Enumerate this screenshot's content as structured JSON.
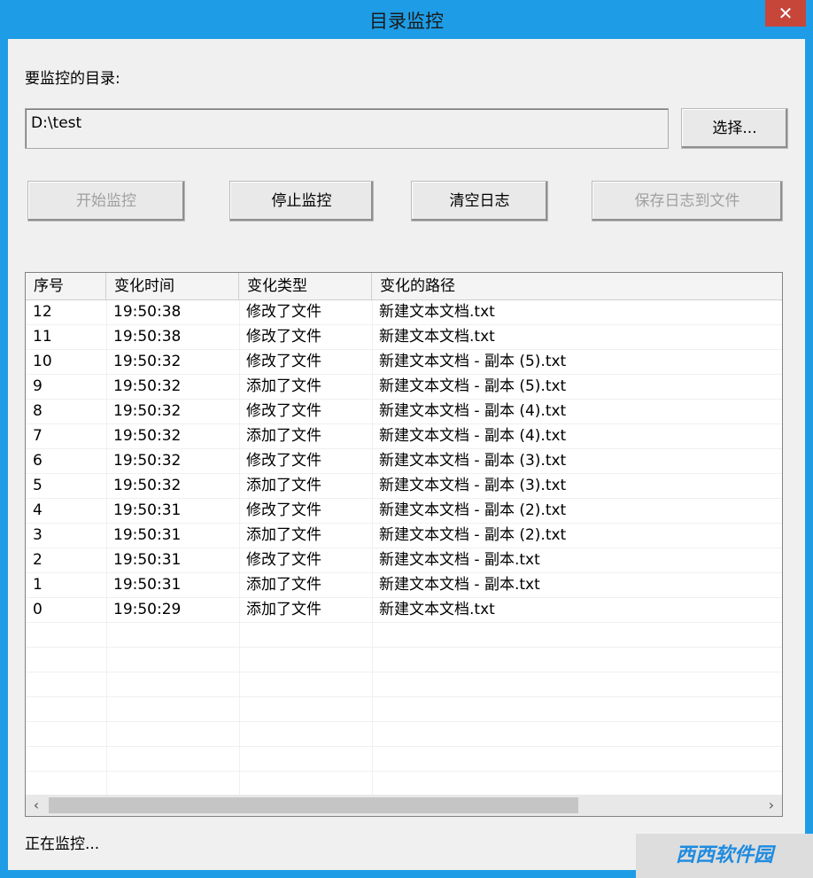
{
  "window": {
    "title": "目录监控",
    "close_label": "✕"
  },
  "dir": {
    "label": "要监控的目录:",
    "value": "D:\\test"
  },
  "buttons": {
    "choose": "选择...",
    "start": "开始监控",
    "stop": "停止监控",
    "clear": "清空日志",
    "save": "保存日志到文件"
  },
  "table": {
    "columns": [
      "序号",
      "变化时间",
      "变化类型",
      "变化的路径"
    ],
    "rows": [
      [
        "12",
        "19:50:38",
        "修改了文件",
        "新建文本文档.txt"
      ],
      [
        "11",
        "19:50:38",
        "修改了文件",
        "新建文本文档.txt"
      ],
      [
        "10",
        "19:50:32",
        "修改了文件",
        "新建文本文档 - 副本 (5).txt"
      ],
      [
        "9",
        "19:50:32",
        "添加了文件",
        "新建文本文档 - 副本 (5).txt"
      ],
      [
        "8",
        "19:50:32",
        "修改了文件",
        "新建文本文档 - 副本 (4).txt"
      ],
      [
        "7",
        "19:50:32",
        "添加了文件",
        "新建文本文档 - 副本 (4).txt"
      ],
      [
        "6",
        "19:50:32",
        "修改了文件",
        "新建文本文档 - 副本 (3).txt"
      ],
      [
        "5",
        "19:50:32",
        "添加了文件",
        "新建文本文档 - 副本 (3).txt"
      ],
      [
        "4",
        "19:50:31",
        "修改了文件",
        "新建文本文档 - 副本 (2).txt"
      ],
      [
        "3",
        "19:50:31",
        "添加了文件",
        "新建文本文档 - 副本 (2).txt"
      ],
      [
        "2",
        "19:50:31",
        "修改了文件",
        "新建文本文档 - 副本.txt"
      ],
      [
        "1",
        "19:50:31",
        "添加了文件",
        "新建文本文档 - 副本.txt"
      ],
      [
        "0",
        "19:50:29",
        "添加了文件",
        "新建文本文档.txt"
      ]
    ],
    "scroll_left": "‹",
    "scroll_right": "›"
  },
  "status": "正在监控...",
  "watermark": "西西软件园"
}
